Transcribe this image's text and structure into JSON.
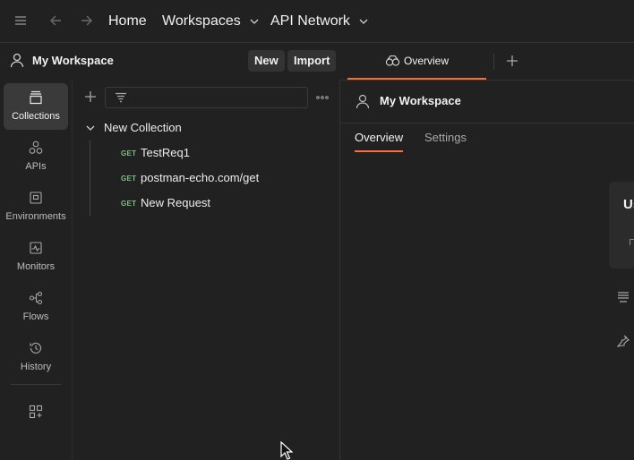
{
  "topbar": {
    "home": "Home",
    "workspaces": "Workspaces",
    "api_network": "API Network"
  },
  "workspace_header": {
    "name": "My Workspace",
    "new_button": "New",
    "import_button": "Import"
  },
  "nav": {
    "items": [
      {
        "label": "Collections",
        "icon": "collections-icon",
        "active": true
      },
      {
        "label": "APIs",
        "icon": "apis-icon"
      },
      {
        "label": "Environments",
        "icon": "environments-icon"
      },
      {
        "label": "Monitors",
        "icon": "monitors-icon"
      },
      {
        "label": "Flows",
        "icon": "flows-icon"
      },
      {
        "label": "History",
        "icon": "history-icon"
      }
    ]
  },
  "collection": {
    "name": "New Collection",
    "requests": [
      {
        "method": "GET",
        "name": "TestReq1"
      },
      {
        "method": "GET",
        "name": "postman-echo.com/get"
      },
      {
        "method": "GET",
        "name": "New Request"
      }
    ]
  },
  "tabs": {
    "overview": "Overview"
  },
  "overview": {
    "title": "My Workspace",
    "subtabs": [
      "Overview",
      "Settings"
    ],
    "card_text": "Us"
  },
  "colors": {
    "accent": "#ff6c37",
    "get_method": "#7fbf7f",
    "background": "#212121"
  }
}
